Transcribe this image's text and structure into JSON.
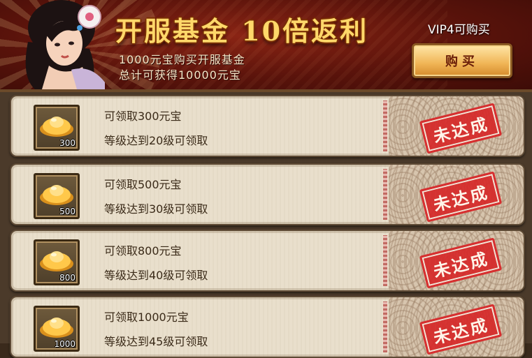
{
  "banner": {
    "title": "开服基金 10倍返利",
    "line1": "1000元宝购买开服基金",
    "line2": "总计可获得10000元宝",
    "vip_label": "VIP4可购买",
    "buy_label": "购买"
  },
  "rewards": [
    {
      "count": "300",
      "reward": "可领取300元宝",
      "condition": "等级达到20级可领取",
      "status": "未达成"
    },
    {
      "count": "500",
      "reward": "可领取500元宝",
      "condition": "等级达到30级可领取",
      "status": "未达成"
    },
    {
      "count": "800",
      "reward": "可领取800元宝",
      "condition": "等级达到40级可领取",
      "status": "未达成"
    },
    {
      "count": "1000",
      "reward": "可领取1000元宝",
      "condition": "等级达到45级可领取",
      "status": "未达成"
    }
  ]
}
